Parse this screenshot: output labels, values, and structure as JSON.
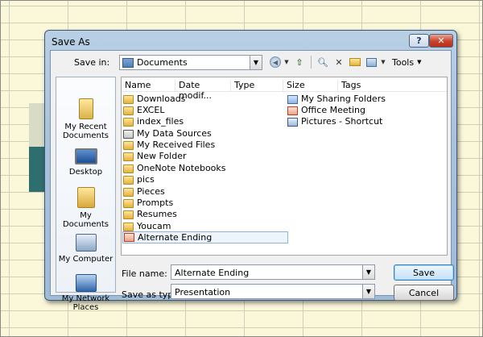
{
  "dialog": {
    "title": "Save As",
    "help_glyph": "?",
    "close_glyph": "✕"
  },
  "location": {
    "label": "Save in:",
    "value": "Documents"
  },
  "toolbar": {
    "tools_label": "Tools"
  },
  "places": [
    {
      "label_line1": "My Recent",
      "label_line2": "Documents"
    },
    {
      "label_line1": "Desktop",
      "label_line2": ""
    },
    {
      "label_line1": "My Documents",
      "label_line2": ""
    },
    {
      "label_line1": "My Computer",
      "label_line2": ""
    },
    {
      "label_line1": "My Network",
      "label_line2": "Places"
    }
  ],
  "columns": [
    "Name",
    "Date modif...",
    "Type",
    "Size",
    "Tags"
  ],
  "files_left": [
    {
      "name": "Downloads",
      "icon": "folder-icon"
    },
    {
      "name": "EXCEL",
      "icon": "folder-icon"
    },
    {
      "name": "index_files",
      "icon": "folder-icon"
    },
    {
      "name": "My Data Sources",
      "icon": "data-source-icon"
    },
    {
      "name": "My Received Files",
      "icon": "folder-icon"
    },
    {
      "name": "New Folder",
      "icon": "folder-icon"
    },
    {
      "name": "OneNote Notebooks",
      "icon": "folder-icon"
    },
    {
      "name": "pics",
      "icon": "folder-icon"
    },
    {
      "name": "Pieces",
      "icon": "folder-icon"
    },
    {
      "name": "Prompts",
      "icon": "folder-icon"
    },
    {
      "name": "Resumes",
      "icon": "folder-icon"
    },
    {
      "name": "Youcam",
      "icon": "folder-icon"
    },
    {
      "name": "Alternate Ending",
      "icon": "powerpoint-icon",
      "selected": true
    }
  ],
  "files_right": [
    {
      "name": "My Sharing Folders",
      "icon": "sharing-folder-icon"
    },
    {
      "name": "Office Meeting",
      "icon": "powerpoint-icon"
    },
    {
      "name": "Pictures - Shortcut",
      "icon": "shortcut-icon"
    }
  ],
  "form": {
    "filename_label": "File name:",
    "filename_value": "Alternate Ending",
    "filetype_label": "Save as type:",
    "filetype_value": "Presentation"
  },
  "buttons": {
    "save": "Save",
    "cancel": "Cancel"
  }
}
